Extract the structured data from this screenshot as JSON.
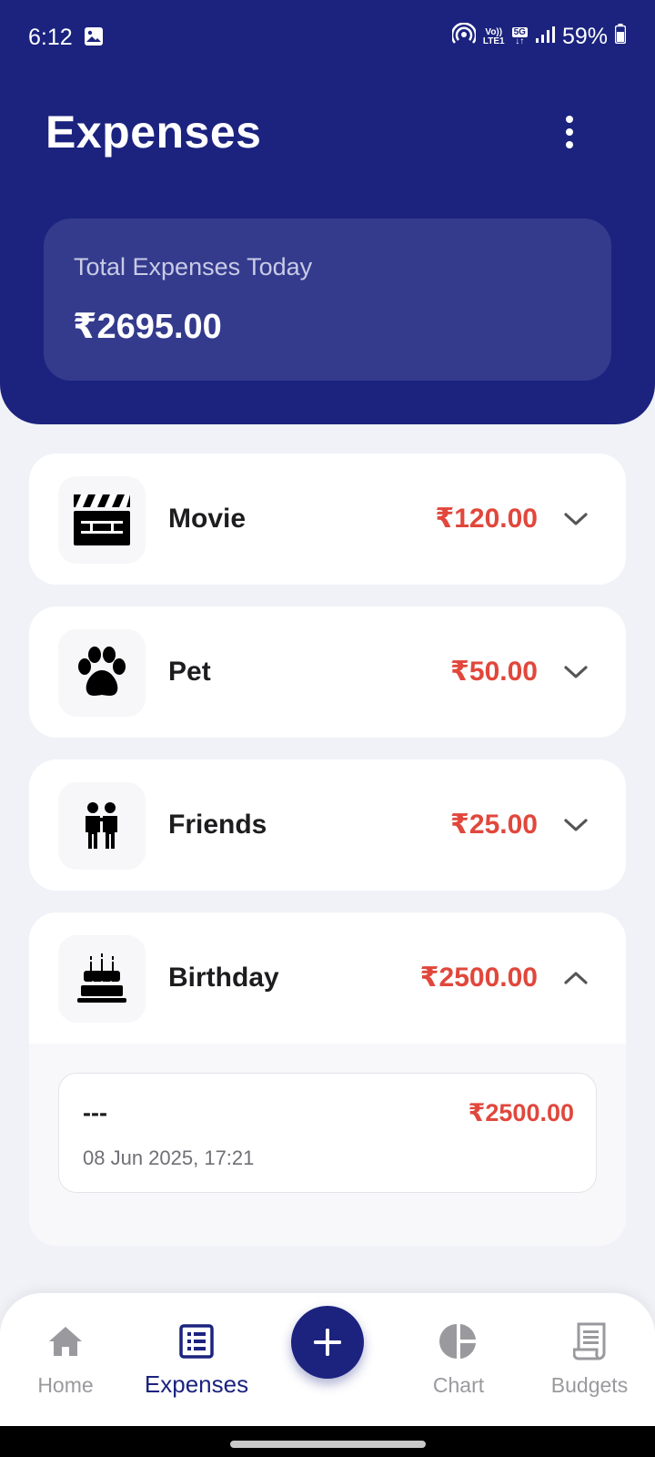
{
  "status_bar": {
    "time": "6:12",
    "network_top": "Vo))",
    "network_bottom": "LTE1",
    "network_type": "5G",
    "battery": "59%"
  },
  "header": {
    "title": "Expenses",
    "summary_label": "Total Expenses Today",
    "summary_value": "₹2695.00"
  },
  "categories": [
    {
      "name": "Movie",
      "amount": "₹120.00",
      "icon": "clapperboard-icon",
      "expanded": false
    },
    {
      "name": "Pet",
      "amount": "₹50.00",
      "icon": "paw-icon",
      "expanded": false
    },
    {
      "name": "Friends",
      "amount": "₹25.00",
      "icon": "friends-icon",
      "expanded": false
    },
    {
      "name": "Birthday",
      "amount": "₹2500.00",
      "icon": "birthday-cake-icon",
      "expanded": true
    }
  ],
  "birthday_entries": [
    {
      "note": "---",
      "date": "08 Jun 2025, 17:21",
      "amount": "₹2500.00"
    }
  ],
  "nav": {
    "home": "Home",
    "expenses": "Expenses",
    "chart": "Chart",
    "budgets": "Budgets",
    "active": "expenses"
  },
  "colors": {
    "primary": "#1b237f",
    "amount": "#e1473c",
    "background": "#f1f2f7"
  }
}
